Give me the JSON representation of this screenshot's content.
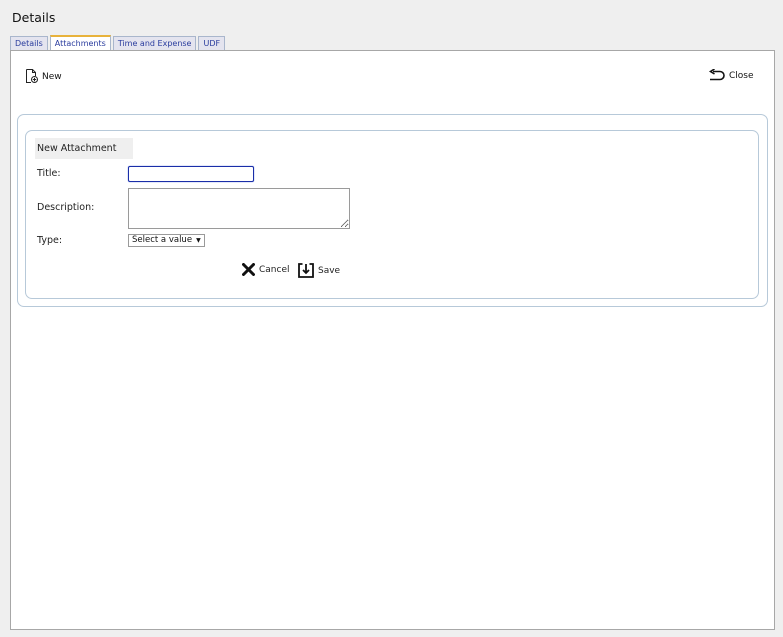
{
  "window": {
    "title": "Details"
  },
  "tabs": [
    {
      "label": "Details"
    },
    {
      "label": "Attachments",
      "active": true
    },
    {
      "label": "Time and Expense"
    },
    {
      "label": "UDF"
    }
  ],
  "toolbar": {
    "new_label": "New",
    "close_label": "Close"
  },
  "form": {
    "legend": "New Attachment",
    "title_label": "Title:",
    "title_value": "",
    "description_label": "Description:",
    "description_value": "",
    "type_label": "Type:",
    "type_selected": "Select a value",
    "cancel_label": "Cancel",
    "save_label": "Save"
  },
  "icons": {
    "new": "new-document-icon",
    "close": "return-arrow-icon",
    "cancel": "x-icon",
    "save": "save-download-icon",
    "dropdown": "triangle-down-icon"
  },
  "colors": {
    "tab_text": "#2a3c9e",
    "active_tab_accent": "#e8b23a",
    "frame_border": "#b7c9d9",
    "focus_border": "#1a2ea8"
  }
}
